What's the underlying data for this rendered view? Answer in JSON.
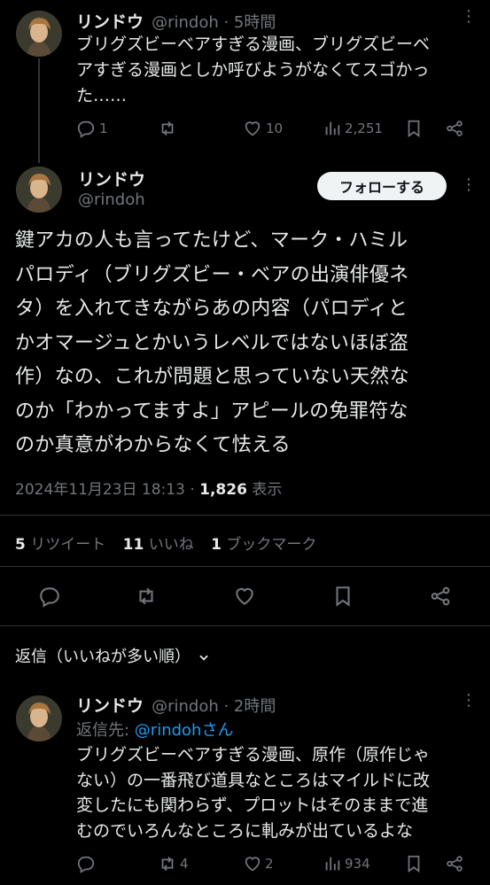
{
  "reply_parent": {
    "author_name": "リンドウ",
    "handle_time": "@rindoh · 5時間",
    "text_lines": [
      "ブリグズビーベアすぎる漫画、ブリグズビーベ",
      "アすぎる漫画としか呼びようがなくてスゴかっ",
      "た……"
    ],
    "reply_count": "1",
    "like_count": "10",
    "view_count": "2,251"
  },
  "main_tweet": {
    "author_name": "リンドウ",
    "handle": "@rindoh",
    "follow_label": "フォローする",
    "text_lines": [
      "鍵アカの人も言ってたけど、マーク・ハミル",
      "パロディ（ブリグズビー・ベアの出演俳優ネ",
      "タ）を入れてきながらあの内容（パロディと",
      "かオマージュとかいうレベルではないほぼ盗",
      "作）なの、これが問題と思っていない天然な",
      "のか「わかってますよ」アピールの免罪符な",
      "のか真意がわからなくて怯える"
    ],
    "timestamp": "2024年11月23日 18:13 · ",
    "views_number": "1,826",
    "views_label": " 表示",
    "retweets_number": "5",
    "retweets_label": " リツイート",
    "likes_number": "11",
    "likes_label": " いいね",
    "bookmarks_number": "1",
    "bookmarks_label": " ブックマーク"
  },
  "sort": {
    "label": "返信（いいねが多い順）"
  },
  "reply": {
    "author_name": "リンドウ",
    "handle_time": "@rindoh · 2時間",
    "replying_prefix": "返信先: ",
    "replying_to": "@rindohさん",
    "text_lines": [
      "ブリグズビーベアすぎる漫画、原作（原作じゃ",
      "ない）の一番飛び道具なところはマイルドに改",
      "変したにも関わらず、プロットはそのままで進",
      "むのでいろんなところに軋みが出ているよな"
    ],
    "retweet_count": "4",
    "like_count": "2",
    "view_count": "934"
  },
  "icons": {
    "reply": "reply-icon",
    "retweet": "retweet-icon",
    "like": "heart-icon",
    "views": "views-icon",
    "bookmark": "bookmark-icon",
    "share": "share-icon",
    "more": "more-icon",
    "chevron": "chevron-down-icon"
  },
  "colors": {
    "background": "#000000",
    "text": "#e7e9ea",
    "secondary": "#71767b",
    "link": "#1d9bf0",
    "follow_bg": "#eff3f4"
  }
}
